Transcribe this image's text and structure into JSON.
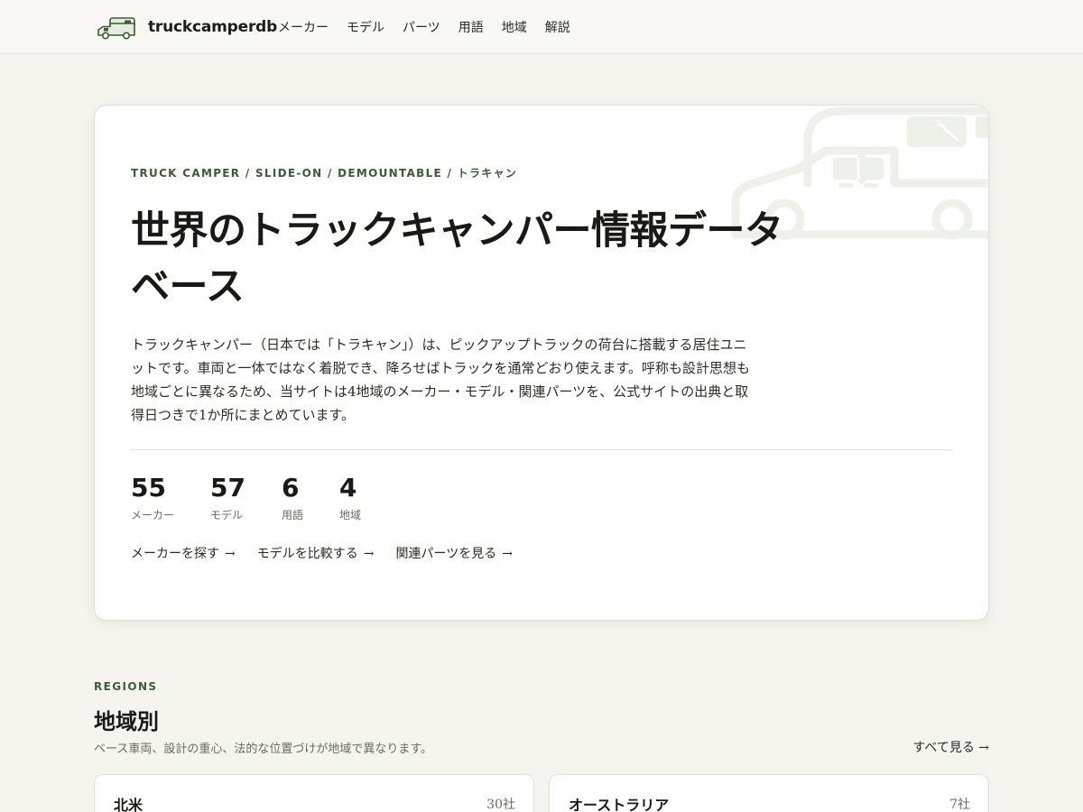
{
  "header": {
    "brand": "truckcamperdb",
    "nav": [
      "メーカー",
      "モデル",
      "パーツ",
      "用語",
      "地域",
      "解説"
    ]
  },
  "hero": {
    "eyebrow": "TRUCK CAMPER / SLIDE-ON / DEMOUNTABLE / トラキャン",
    "title": "世界のトラックキャンパー情報データベース",
    "description": "トラックキャンパー（日本では「トラキャン」）は、ピックアップトラックの荷台に搭載する居住ユニットです。車両と一体ではなく着脱でき、降ろせばトラックを通常どおり使えます。呼称も設計思想も地域ごとに異なるため、当サイトは4地域のメーカー・モデル・関連パーツを、公式サイトの出典と取得日つきで1か所にまとめています。",
    "stats": [
      {
        "value": "55",
        "label": "メーカー"
      },
      {
        "value": "57",
        "label": "モデル"
      },
      {
        "value": "6",
        "label": "用語"
      },
      {
        "value": "4",
        "label": "地域"
      }
    ],
    "links": [
      {
        "label": "メーカーを探す",
        "arrow": "→"
      },
      {
        "label": "モデルを比較する",
        "arrow": "→"
      },
      {
        "label": "関連パーツを見る",
        "arrow": "→"
      }
    ]
  },
  "regions": {
    "eyebrow": "REGIONS",
    "title": "地域別",
    "description": "ベース車両、設計の重心、法的な位置づけが地域で異なります。",
    "see_all": "すべて見る →",
    "cards": [
      {
        "name": "北米",
        "count": "30社"
      },
      {
        "name": "オーストラリア",
        "count": "7社"
      }
    ]
  },
  "colors": {
    "accent": "#3c5c35",
    "background": "#f6f4ef",
    "card": "#ffffff",
    "illustration": "#eef0ea"
  },
  "icons": {
    "brand_logo": "truck-camper-logo-icon",
    "hero_illustration": "truck-camper-illustration-icon"
  }
}
